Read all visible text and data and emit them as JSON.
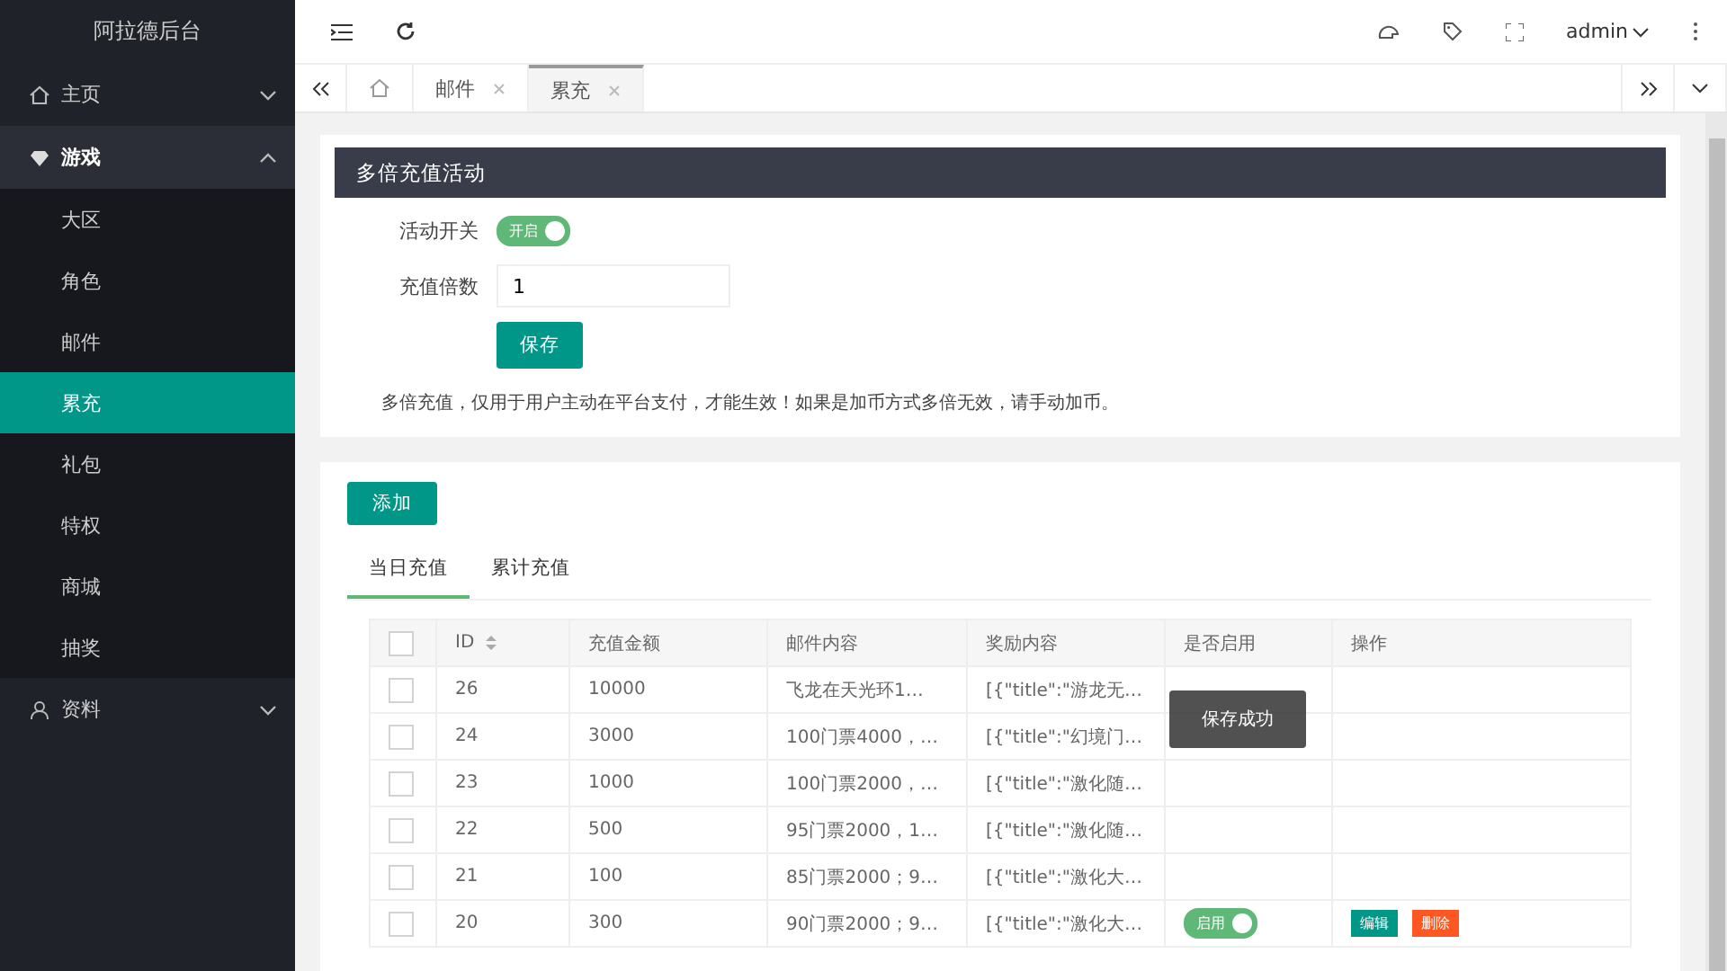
{
  "sidebar": {
    "title": "阿拉德后台",
    "items": [
      {
        "label": "主页",
        "expanded": false
      },
      {
        "label": "游戏",
        "expanded": true,
        "children": [
          {
            "label": "大区",
            "selected": false
          },
          {
            "label": "角色",
            "selected": false
          },
          {
            "label": "邮件",
            "selected": false
          },
          {
            "label": "累充",
            "selected": true
          },
          {
            "label": "礼包",
            "selected": false
          },
          {
            "label": "特权",
            "selected": false
          },
          {
            "label": "商城",
            "selected": false
          },
          {
            "label": "抽奖",
            "selected": false
          }
        ]
      },
      {
        "label": "资料",
        "expanded": false
      }
    ]
  },
  "header": {
    "user": "admin"
  },
  "tabs": [
    {
      "label": "邮件",
      "selected": false
    },
    {
      "label": "累充",
      "selected": true
    }
  ],
  "activity": {
    "title": "多倍充值活动",
    "switch_label": "活动开关",
    "switch": {
      "on": true,
      "text": "开启"
    },
    "multiplier_label": "充值倍数",
    "multiplier": "1",
    "save": "保存",
    "note": "多倍充值，仅用于用户主动在平台支付，才能生效！如果是加币方式多倍无效，请手动加币。"
  },
  "list": {
    "add": "添加",
    "subtabs": [
      {
        "label": "当日充值",
        "selected": true
      },
      {
        "label": "累计充值",
        "selected": false
      }
    ],
    "all_checked": false,
    "columns": [
      "ID",
      "充值金额",
      "邮件内容",
      "奖励内容",
      "是否启用",
      "操作"
    ],
    "rows": [
      {
        "id": "26",
        "amount": "10000",
        "mail": "飞龙在天光环1…",
        "reward": "[{\"title\":\"游龙无…",
        "checked": false
      },
      {
        "id": "24",
        "amount": "3000",
        "mail": "100门票4000，…",
        "reward": "[{\"title\":\"幻境门…",
        "checked": false
      },
      {
        "id": "23",
        "amount": "1000",
        "mail": "100门票2000，…",
        "reward": "[{\"title\":\"激化随…",
        "checked": false
      },
      {
        "id": "22",
        "amount": "500",
        "mail": "95门票2000，1…",
        "reward": "[{\"title\":\"激化随…",
        "checked": false
      },
      {
        "id": "21",
        "amount": "100",
        "mail": "85门票2000；9…",
        "reward": "[{\"title\":\"激化大…",
        "checked": false
      },
      {
        "id": "20",
        "amount": "300",
        "mail": "90门票2000；9…",
        "reward": "[{\"title\":\"激化大…",
        "checked": false,
        "enabled": {
          "on": true,
          "text": "启用"
        },
        "actions": [
          "编辑",
          "删除"
        ]
      }
    ]
  },
  "toast": "保存成功"
}
